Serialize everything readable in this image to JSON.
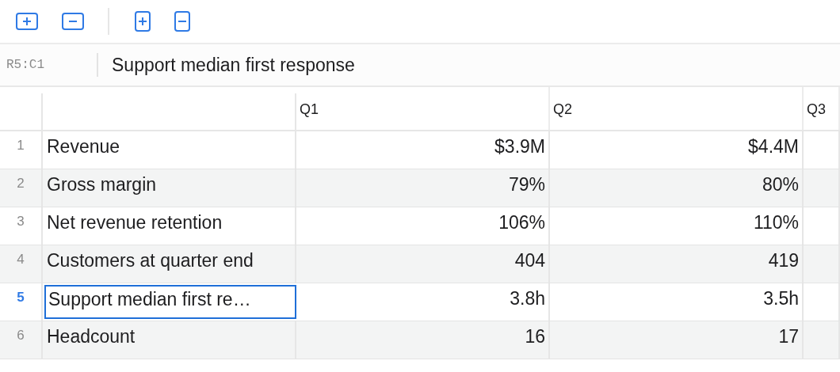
{
  "toolbar": {
    "groups": [
      {
        "kind": "row",
        "buttons": [
          {
            "kind": "add"
          },
          {
            "kind": "remove"
          }
        ]
      },
      {
        "kind": "column",
        "buttons": [
          {
            "kind": "add"
          },
          {
            "kind": "remove"
          }
        ]
      }
    ]
  },
  "formula_bar": {
    "cell_ref": "R5:C1",
    "value": "Support median first response"
  },
  "table": {
    "columns": [
      "Q1",
      "Q2",
      "Q3"
    ],
    "rows": [
      {
        "number": "1",
        "label": "Revenue",
        "values": [
          "$3.9M",
          "$4.4M"
        ],
        "selected": false
      },
      {
        "number": "2",
        "label": "Gross margin",
        "values": [
          "79%",
          "80%"
        ],
        "selected": false
      },
      {
        "number": "3",
        "label": "Net revenue retention",
        "values": [
          "106%",
          "110%"
        ],
        "selected": false
      },
      {
        "number": "4",
        "label": "Customers at quarter end",
        "values": [
          "404",
          "419"
        ],
        "selected": false
      },
      {
        "number": "5",
        "label": "Support median first re…",
        "values": [
          "3.8h",
          "3.5h"
        ],
        "selected": true
      },
      {
        "number": "6",
        "label": "Headcount",
        "values": [
          "16",
          "17"
        ],
        "selected": false
      }
    ]
  }
}
